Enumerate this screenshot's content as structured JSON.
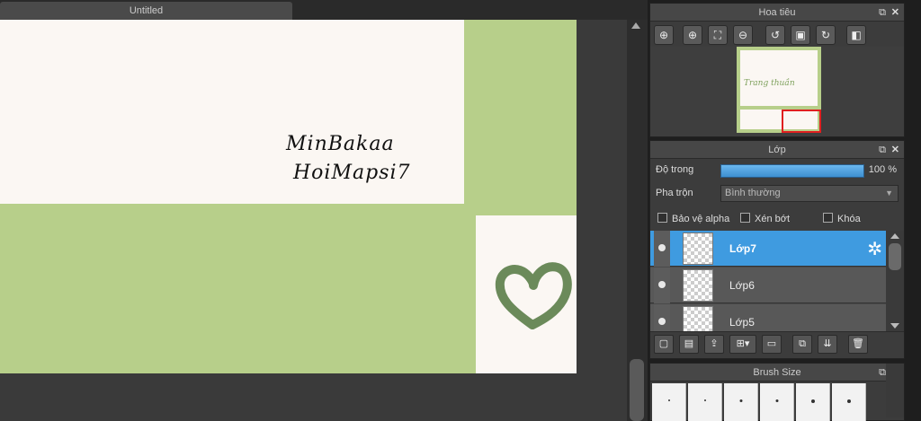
{
  "document": {
    "tab_title": "Untitled"
  },
  "canvas": {
    "text_line1": "MinBakaa",
    "text_line2": "HoiMapsi7",
    "colors": {
      "green": "#b7cf8a",
      "cream": "#fbf7f3",
      "heart": "#6b8a5a"
    }
  },
  "navigator": {
    "title": "Hoa tiêu",
    "preview_text": "Trang thuần",
    "tools": [
      "zoom-fit-icon",
      "zoom-in-icon",
      "fit-window-icon",
      "zoom-out-icon",
      "rotate-left-icon",
      "fullscreen-icon",
      "rotate-right-icon",
      "flip-icon"
    ]
  },
  "layers_panel": {
    "title": "Lớp",
    "opacity_label": "Độ trong",
    "opacity_value": "100 %",
    "opacity_fraction": 1.0,
    "blend_label": "Pha trộn",
    "blend_value": "Bình thường",
    "checks": {
      "protect_alpha": "Bảo vệ alpha",
      "clipping": "Xén bớt",
      "lock": "Khóa"
    },
    "layers": [
      {
        "name": "Lớp7",
        "selected": true
      },
      {
        "name": "Lớp6",
        "selected": false
      },
      {
        "name": "Lớp5",
        "selected": false
      }
    ]
  },
  "brush_panel": {
    "title": "Brush Size"
  }
}
